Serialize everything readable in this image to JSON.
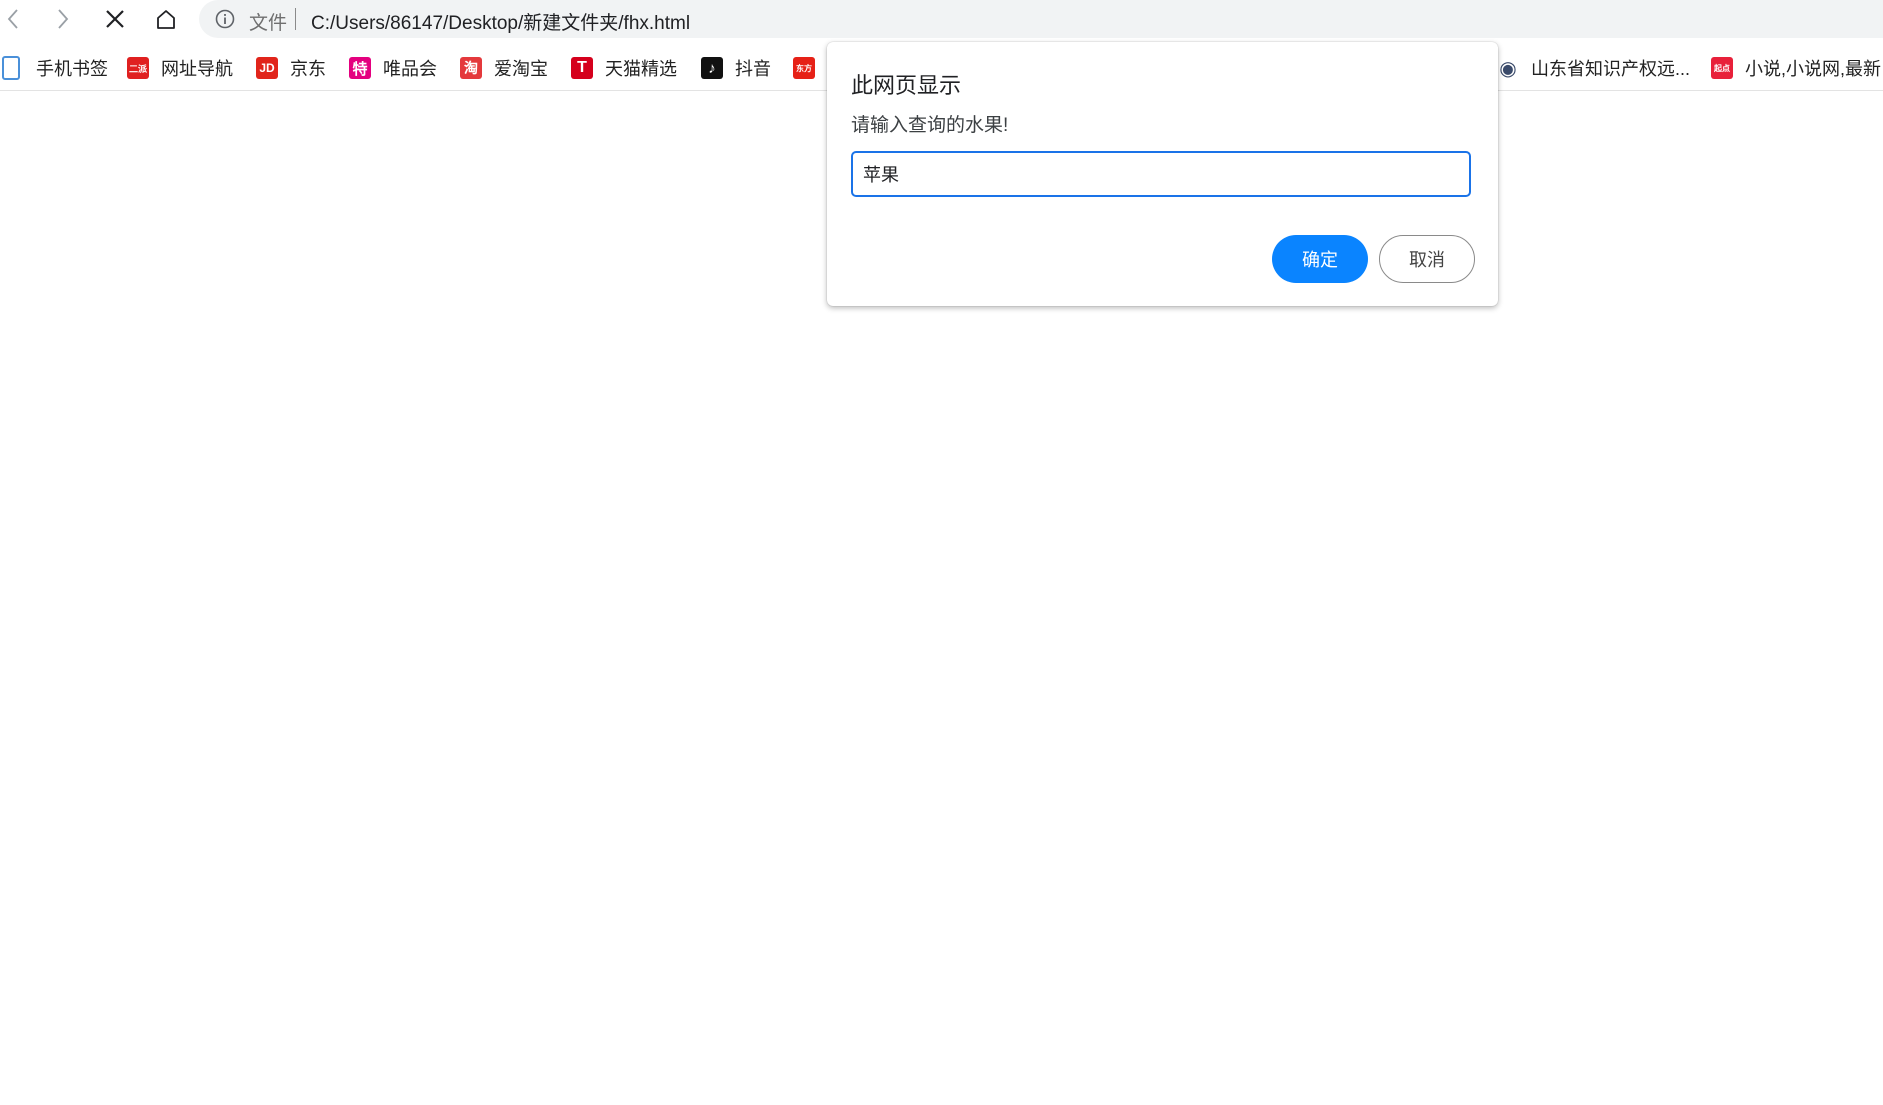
{
  "browser": {
    "scheme_label": "文件",
    "url": "C:/Users/86147/Desktop/新建文件夹/fhx.html"
  },
  "bookmarks": [
    {
      "label": "手机书签",
      "icon": "phone-bookmark-icon",
      "color": "#4a90d9"
    },
    {
      "label": "网址导航",
      "icon": "nav-site-icon",
      "color": "#e02020",
      "glyph": "二派"
    },
    {
      "label": "京东",
      "icon": "jd-icon",
      "color": "#e1251b",
      "glyph": "JD"
    },
    {
      "label": "唯品会",
      "icon": "vip-icon",
      "color": "#e4007f",
      "glyph": "特"
    },
    {
      "label": "爱淘宝",
      "icon": "taobao-icon",
      "color": "#e4393c",
      "glyph": "淘"
    },
    {
      "label": "天猫精选",
      "icon": "tmall-icon",
      "color": "#d5001c",
      "glyph": "T"
    },
    {
      "label": "抖音",
      "icon": "douyin-icon",
      "color": "#111111",
      "glyph": "♪"
    },
    {
      "label": "",
      "icon": "dongfang-icon",
      "color": "#e62117",
      "glyph": "东方"
    },
    {
      "label": "山东省知识产权远...",
      "icon": "sd-ip-icon",
      "color": "#3a4a6a",
      "glyph": "◉"
    },
    {
      "label": "小说,小说网,最新",
      "icon": "qidian-icon",
      "color": "#e8203a",
      "glyph": "起点"
    }
  ],
  "dialog": {
    "title": "此网页显示",
    "message": "请输入查询的水果!",
    "input_value": "苹果",
    "ok_label": "确定",
    "cancel_label": "取消"
  }
}
